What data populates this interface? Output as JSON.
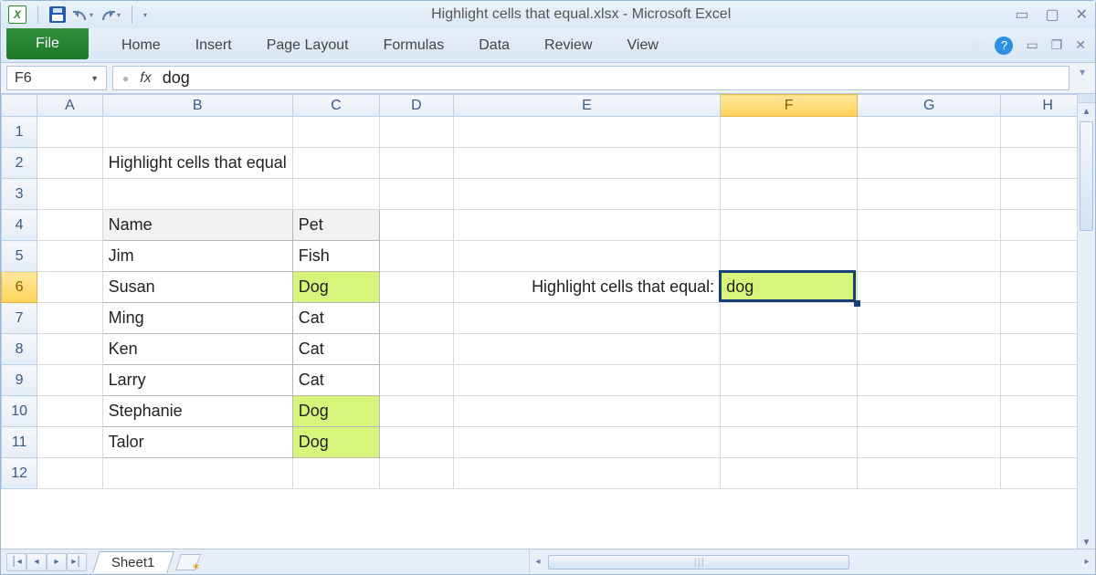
{
  "titlebar": {
    "qat_excel": "X",
    "title": "Highlight cells that equal.xlsx - Microsoft Excel"
  },
  "ribbon": {
    "file": "File",
    "tabs": [
      "Home",
      "Insert",
      "Page Layout",
      "Formulas",
      "Data",
      "Review",
      "View"
    ],
    "help_symbol": "?"
  },
  "formula": {
    "namebox": "F6",
    "fx_label": "fx",
    "value": "dog"
  },
  "columns": [
    "A",
    "B",
    "C",
    "D",
    "E",
    "F",
    "G",
    "H"
  ],
  "active_column": "F",
  "row_count": 12,
  "active_row": 6,
  "sheet": {
    "title_text": "Highlight cells that equal",
    "headers": {
      "name": "Name",
      "pet": "Pet"
    },
    "rows": [
      {
        "name": "Jim",
        "pet": "Fish",
        "hl": false
      },
      {
        "name": "Susan",
        "pet": "Dog",
        "hl": true
      },
      {
        "name": "Ming",
        "pet": "Cat",
        "hl": false
      },
      {
        "name": "Ken",
        "pet": "Cat",
        "hl": false
      },
      {
        "name": "Larry",
        "pet": "Cat",
        "hl": false
      },
      {
        "name": "Stephanie",
        "pet": "Dog",
        "hl": true
      },
      {
        "name": "Talor",
        "pet": "Dog",
        "hl": true
      }
    ],
    "prompt_label": "Highlight cells that equal:",
    "prompt_value": "dog"
  },
  "tabs": {
    "sheet_name": "Sheet1"
  },
  "colors": {
    "highlight": "#d7f57a",
    "selection": "#1a3e78",
    "col_active": "#ffd35a"
  }
}
